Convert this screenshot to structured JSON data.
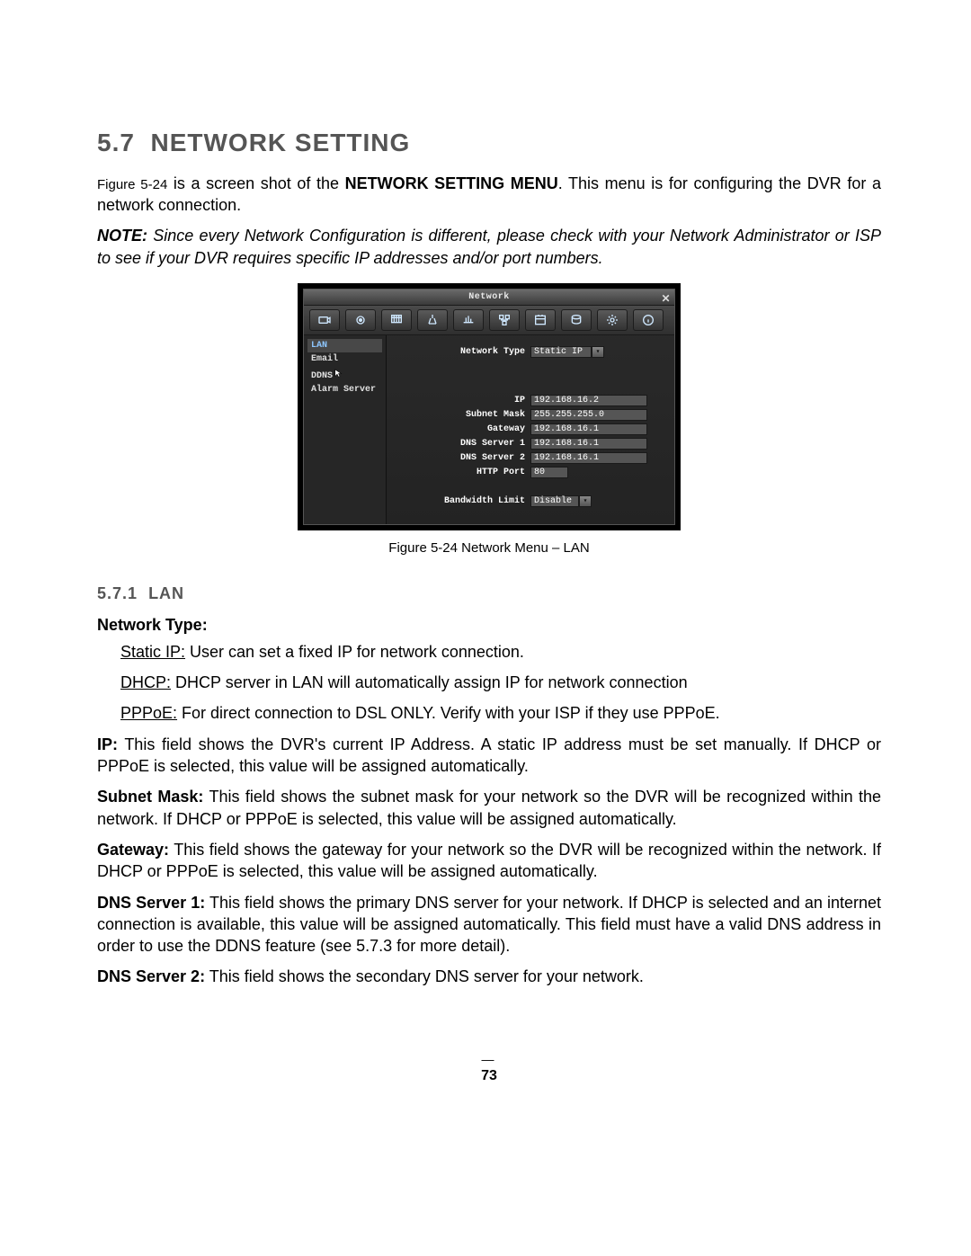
{
  "section": {
    "number": "5.7",
    "title": "NETWORK SETTING"
  },
  "intro": {
    "fig_ref": "Figure 5-24",
    "text_part1": " is a screen shot of the ",
    "bold": "NETWORK SETTING MENU",
    "text_part2": ". This menu is for configuring the DVR for a network connection."
  },
  "note": {
    "label": "NOTE:",
    "text": " Since every Network Configuration is different, please check with your Network Administrator or ISP to see if your DVR requires specific IP addresses and/or port numbers."
  },
  "screenshot": {
    "title": "Network",
    "sidebar": {
      "items": [
        "LAN",
        "Email",
        "DDNS",
        "Alarm Server"
      ],
      "selected": 0,
      "cursor_on": 2
    },
    "fields": {
      "network_type": {
        "label": "Network Type",
        "value": "Static IP"
      },
      "ip": {
        "label": "IP",
        "value": "192.168.16.2"
      },
      "subnet": {
        "label": "Subnet Mask",
        "value": "255.255.255.0"
      },
      "gateway": {
        "label": "Gateway",
        "value": "192.168.16.1"
      },
      "dns1": {
        "label": "DNS Server 1",
        "value": "192.168.16.1"
      },
      "dns2": {
        "label": "DNS Server 2",
        "value": "192.168.16.1"
      },
      "http": {
        "label": "HTTP Port",
        "value": "80"
      },
      "bw": {
        "label": "Bandwidth Limit",
        "value": "Disable"
      }
    }
  },
  "caption": "Figure 5-24 Network Menu – LAN",
  "subsection": {
    "number": "5.7.1",
    "title": "LAN"
  },
  "network_type_heading": "Network Type:",
  "types": {
    "static": {
      "label": "Static IP:",
      "text": " User can set a fixed IP for network connection."
    },
    "dhcp": {
      "label": "DHCP:",
      "text": " DHCP server in LAN will automatically assign IP for network connection"
    },
    "pppoe": {
      "label": "PPPoE:",
      "text": " For direct connection to DSL ONLY. Verify with your ISP if they use PPPoE."
    }
  },
  "paragraphs": {
    "ip": {
      "label": "IP:",
      "text": " This field shows the DVR's current IP Address. A static IP address must be set manually. If DHCP or PPPoE is selected, this value will be assigned automatically."
    },
    "subnet": {
      "label": "Subnet Mask:",
      "text": " This field shows the subnet mask for your network so the DVR will be recognized within the network. If DHCP or PPPoE is selected, this value will be assigned automatically."
    },
    "gw": {
      "label": "Gateway:",
      "text": " This field shows the gateway for your network so the DVR will be recognized within the network. If DHCP or PPPoE is selected, this value will be assigned automatically."
    },
    "dns1": {
      "label": "DNS Server 1:",
      "text": " This field shows the primary DNS server for your network. If DHCP is selected and an internet connection is available, this value will be assigned automatically. This field must have a valid DNS address in order to use the DDNS feature (see 5.7.3 for more detail)."
    },
    "dns2": {
      "label": "DNS Server 2:",
      "text": " This field shows the secondary DNS server for your network."
    }
  },
  "page_number": "73"
}
